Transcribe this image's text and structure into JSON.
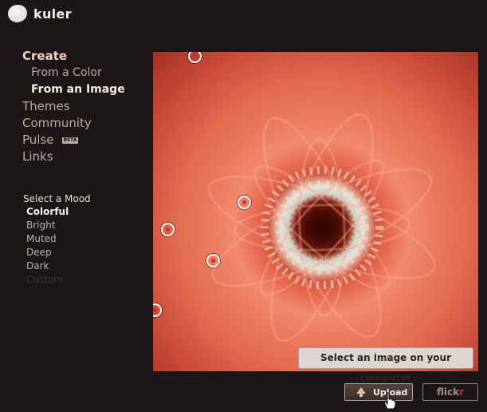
{
  "app": {
    "name": "kuler"
  },
  "nav": {
    "create": "Create",
    "from_color": "From a Color",
    "from_image": "From an Image",
    "themes": "Themes",
    "community": "Community",
    "pulse": "Pulse",
    "pulse_badge": "BETA",
    "links": "Links"
  },
  "mood": {
    "title": "Select a Mood",
    "options": [
      "Colorful",
      "Bright",
      "Muted",
      "Deep",
      "Dark",
      "Custom"
    ],
    "selected": "Colorful"
  },
  "image_picker": {
    "tooltip": "Select an image on your computer",
    "picker_colors": [
      "#c2362a",
      "#c2362a",
      "#c2362a",
      "#c2362a",
      "#c2362a"
    ]
  },
  "buttons": {
    "upload": "Upload",
    "flickr_prefix": "flick",
    "flickr_suffix": "r"
  },
  "colors": {
    "background": "#1c1716",
    "accent": "#f3cfc5",
    "flickr_pink": "#c2362a"
  }
}
